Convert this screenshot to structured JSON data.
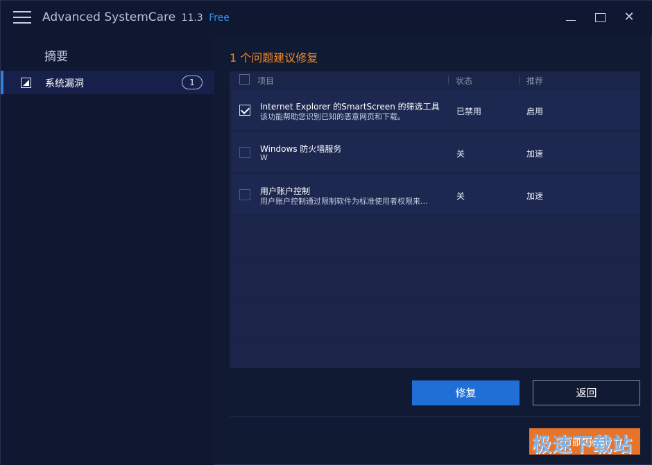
{
  "app": {
    "name": "Advanced SystemCare",
    "version": "11.3",
    "edition": "Free"
  },
  "window_controls": {
    "close_glyph": "✕"
  },
  "sidebar": {
    "heading": "摘要",
    "items": [
      {
        "label": "系统漏洞",
        "count": "1"
      }
    ]
  },
  "main": {
    "heading": "1 个问题建议修复",
    "columns": {
      "item": "项目",
      "status": "状态",
      "recommend": "推荐"
    },
    "rows": [
      {
        "checked": true,
        "title": "Internet Explorer 的SmartScreen 的筛选工具",
        "description": "该功能帮助您识别已知的恶意网页和下载。",
        "status": "已禁用",
        "recommend": "启用"
      },
      {
        "checked": false,
        "title": "Windows 防火墙服务",
        "description": "W",
        "status": "关",
        "recommend": "加速"
      },
      {
        "checked": false,
        "title": "用户账户控制",
        "description": "用户账户控制通过限制软件为标准使用者权限来…",
        "status": "关",
        "recommend": "加速"
      }
    ]
  },
  "buttons": {
    "fix": "修复",
    "back": "返回"
  },
  "watermark": {
    "text": "极速下载站",
    "sub": "即刻修复"
  },
  "colors": {
    "accent_blue": "#1f6fd6",
    "heading_orange": "#f08a2a",
    "background": "#111a33"
  }
}
